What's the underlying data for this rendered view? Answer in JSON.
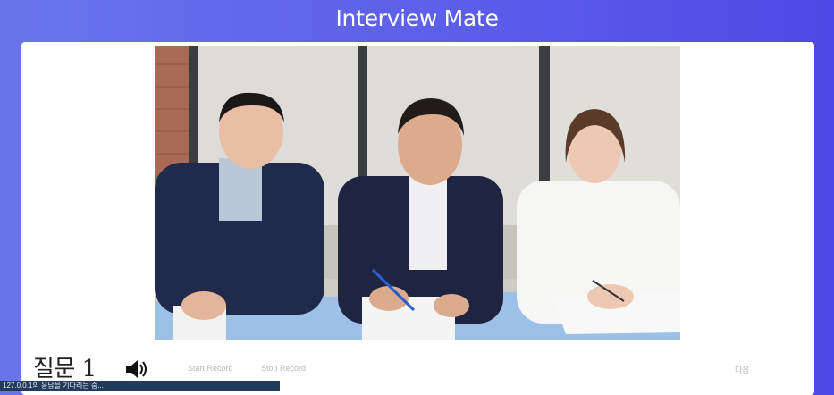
{
  "app": {
    "title": "Interview Mate"
  },
  "question": {
    "label": "질문 1"
  },
  "controls": {
    "start_record": "Start Record",
    "stop_record": "Stop Record",
    "next": "다음"
  },
  "status_bar": {
    "text": "127.0.0.1의 응답을 기다리는 중..."
  },
  "icons": {
    "speaker": "speaker-volume-icon"
  }
}
